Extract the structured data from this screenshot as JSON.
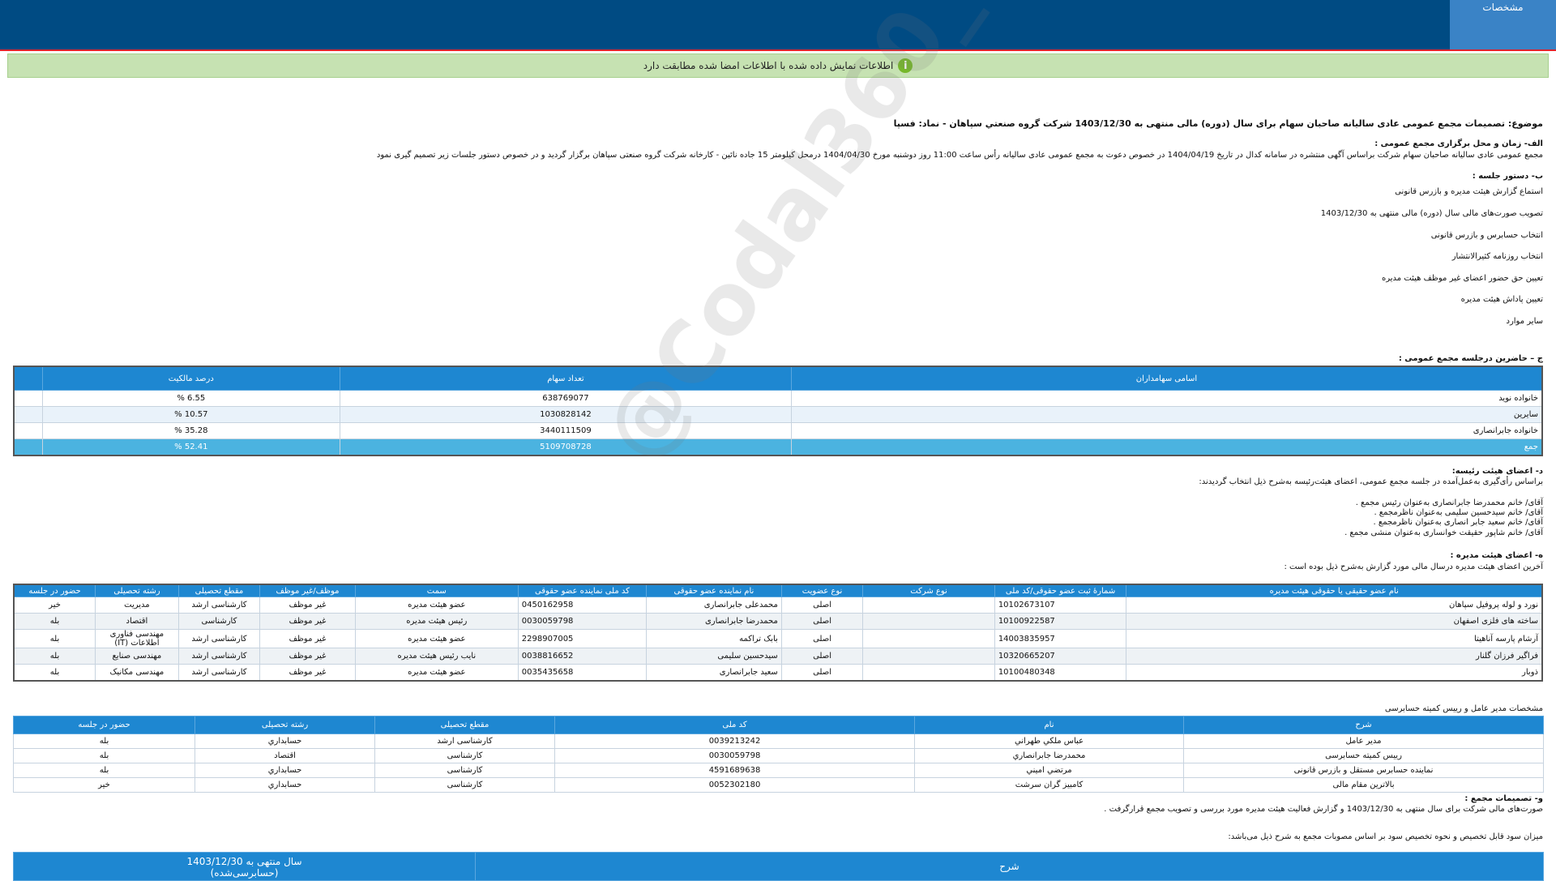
{
  "header": {
    "tab_label": "مشخصات"
  },
  "info": {
    "message": "اطلاعات نمایش داده شده با اطلاعات امضا شده مطابقت دارد"
  },
  "subject": "موضوع: تصمیمات مجمع عمومی عادی سالیانه صاحبان سهام برای سال (دوره) مالی منتهی به 1403/12/30 شرکت گروه صنعتي سپاهان - نماد: فسپا",
  "section_a": {
    "heading": "الف- زمان و محل برگزاری مجمع عمومی :",
    "text": "مجمع عمومی عادی سالیانه صاحبان سهام شرکت براساس آگهی منتشره در سامانه کدال در تاریخ 1404/04/19 در خصوص دعوت به مجمع عمومی عادی سالیانه رأس ساعت 11:00 روز دوشنبه مورخ 1404/04/30 درمحل  کیلومتر 15 جاده نائین - کارخانه شرکت گروه صنعتی سپاهان   برگزار گردید و در خصوص دستور جلسات زیر تصمیم گیری نمود"
  },
  "section_b": {
    "heading": "ب- دستور جلسه :",
    "items": [
      "استماع گزارش هیئت مدیره و بازرس قانونی",
      "تصویب صورت‌های مالی سال (دوره) مالی منتهی به 1403/12/30",
      "انتخاب حسابرس و بازرس قانونی",
      "انتخاب روزنامه کثیرالانتشار",
      "تعیین حق حضور اعضای غیر موظف هیئت مدیره",
      "تعیین پاداش هیئت مدیره",
      "سایر موارد"
    ]
  },
  "section_c": {
    "heading": "ج – حاضرین درجلسه مجمع عمومی :",
    "columns": [
      "اسامی سهامداران",
      "تعداد سهام",
      "درصد مالکیت"
    ],
    "rows": [
      [
        "خانواده نوید",
        "638769077",
        "6.55 %"
      ],
      [
        "سایرین",
        "1030828142",
        "10.57 %"
      ],
      [
        "خانواده جابرانصاری",
        "3440111509",
        "35.28 %"
      ],
      [
        "جمع",
        "5109708728",
        "52.41 %"
      ]
    ]
  },
  "section_d": {
    "heading": "د- اعضای هیئت رئیسه:",
    "intro": "براساس رأی‌گیری به‌عمل‌آمده در جلسه مجمع عمومی، اعضای هیئت‌رئیسه به‌شرح ذیل انتخاب گردیدند:",
    "members": [
      "آقای/ خانم  محمدرضا جابرانصاری  به‌عنوان رئیس مجمع .",
      "آقای/ خانم  سیدحسین سلیمی  به‌عنوان ناظرمجمع .",
      "آقای/ خانم  سعید جابر انصاری  به‌عنوان ناظرمجمع .",
      "آقای/ خانم  شاپور حقیقت خوانساری  به‌عنوان منشی مجمع ."
    ]
  },
  "section_e": {
    "heading": "ه- اعضای هیئت مدیره :",
    "intro": "آخرین اعضای هیئت مدیره درسال مالی مورد گزارش به‌شرح ذیل بوده است :",
    "columns": [
      "نام عضو حقیقی یا حقوقی هیئت مدیره",
      "شمارهٔ ثبت عضو حقوقی/کد ملی",
      "نوع شرکت",
      "نوع عضویت",
      "نام نماینده عضو حقوقی",
      "کد ملی نماینده عضو حقوقی",
      "سمت",
      "موظف/غیر موظف",
      "مقطع تحصیلی",
      "رشته تحصیلی",
      "حضور در جلسه"
    ],
    "rows": [
      [
        "نورد و لوله پروفیل سپاهان",
        "10102673107",
        "",
        "اصلی",
        "محمدعلی جابرانصاری",
        "0450162958",
        "عضو هیئت مدیره",
        "غیر موظف",
        "کارشناسی ارشد",
        "مدیریت",
        "خیر"
      ],
      [
        "ساخته های فلزی اصفهان",
        "10100922587",
        "",
        "اصلی",
        "محمدرضا جابرانصاری",
        "0030059798",
        "رئیس هیئت مدیره",
        "غیر موظف",
        "کارشناسی",
        "اقتصاد",
        "بله"
      ],
      [
        "آرشام پارسه آناهیتا",
        "14003835957",
        "",
        "اصلی",
        "بابک تراکمه",
        "2298907005",
        "عضو هیئت مدیره",
        "غیر موظف",
        "کارشناسی ارشد",
        "مهندسی فناوری اطلاعات (IT)",
        "بله"
      ],
      [
        "فراگیر فرزان گلنار",
        "10320665207",
        "",
        "اصلی",
        "سیدحسین سلیمی",
        "0038816652",
        "نایب رئیس هیئت مدیره",
        "غیر موظف",
        "کارشناسی ارشد",
        "مهندسی صنایع",
        "بله"
      ],
      [
        "ذوبار",
        "10100480348",
        "",
        "اصلی",
        "سعید جابرانصاری",
        "0035435658",
        "عضو هیئت مدیره",
        "غیر موظف",
        "کارشناسی ارشد",
        "مهندسی مکانیک",
        "بله"
      ]
    ]
  },
  "managers": {
    "heading": "مشخصات مدیر عامل و رییس کمیته حسابرسی",
    "columns": [
      "شرح",
      "نام",
      "کد ملی",
      "مقطع تحصیلی",
      "رشته تحصیلی",
      "حضور در جلسه"
    ],
    "rows": [
      [
        "مدیر عامل",
        "عباس ملکي طهراني",
        "0039213242",
        "کارشناسی ارشد",
        "حسابداري",
        "بله"
      ],
      [
        "رییس کمیته حسابرسی",
        "محمدرضا  جابرانصاري",
        "0030059798",
        "کارشناسی",
        "اقتصاد",
        "بله"
      ],
      [
        "نماینده حسابرس مستقل و بازرس قانونی",
        "مرتضي اميني",
        "4591689638",
        "کارشناسی",
        "حسابداري",
        "بله"
      ],
      [
        "بالاترین مقام مالی",
        "كامبيز گران سرشت",
        "0052302180",
        "کارشناسی",
        "حسابداري",
        "خير"
      ]
    ]
  },
  "section_f": {
    "heading": "و- تصمیمات مجمع :",
    "text": "صورت‌های مالی شرکت برای سال منتهی به  1403/12/30 و گزارش فعالیت هیئت مدیره مورد بررسی و تصویب مجمع قرارگرفت .",
    "profit_intro": "میزان سود قابل تخصیص و نحوه تخصیص سود بر اساس مصوبات مجمع به شرح ذیل می‌باشد:",
    "table_header_desc": "شرح",
    "table_header_year": "سال منتهی به 1403/12/30",
    "table_header_year_sub": "(حسابرسی‌شده)"
  },
  "watermark": "@Codal360_ir"
}
